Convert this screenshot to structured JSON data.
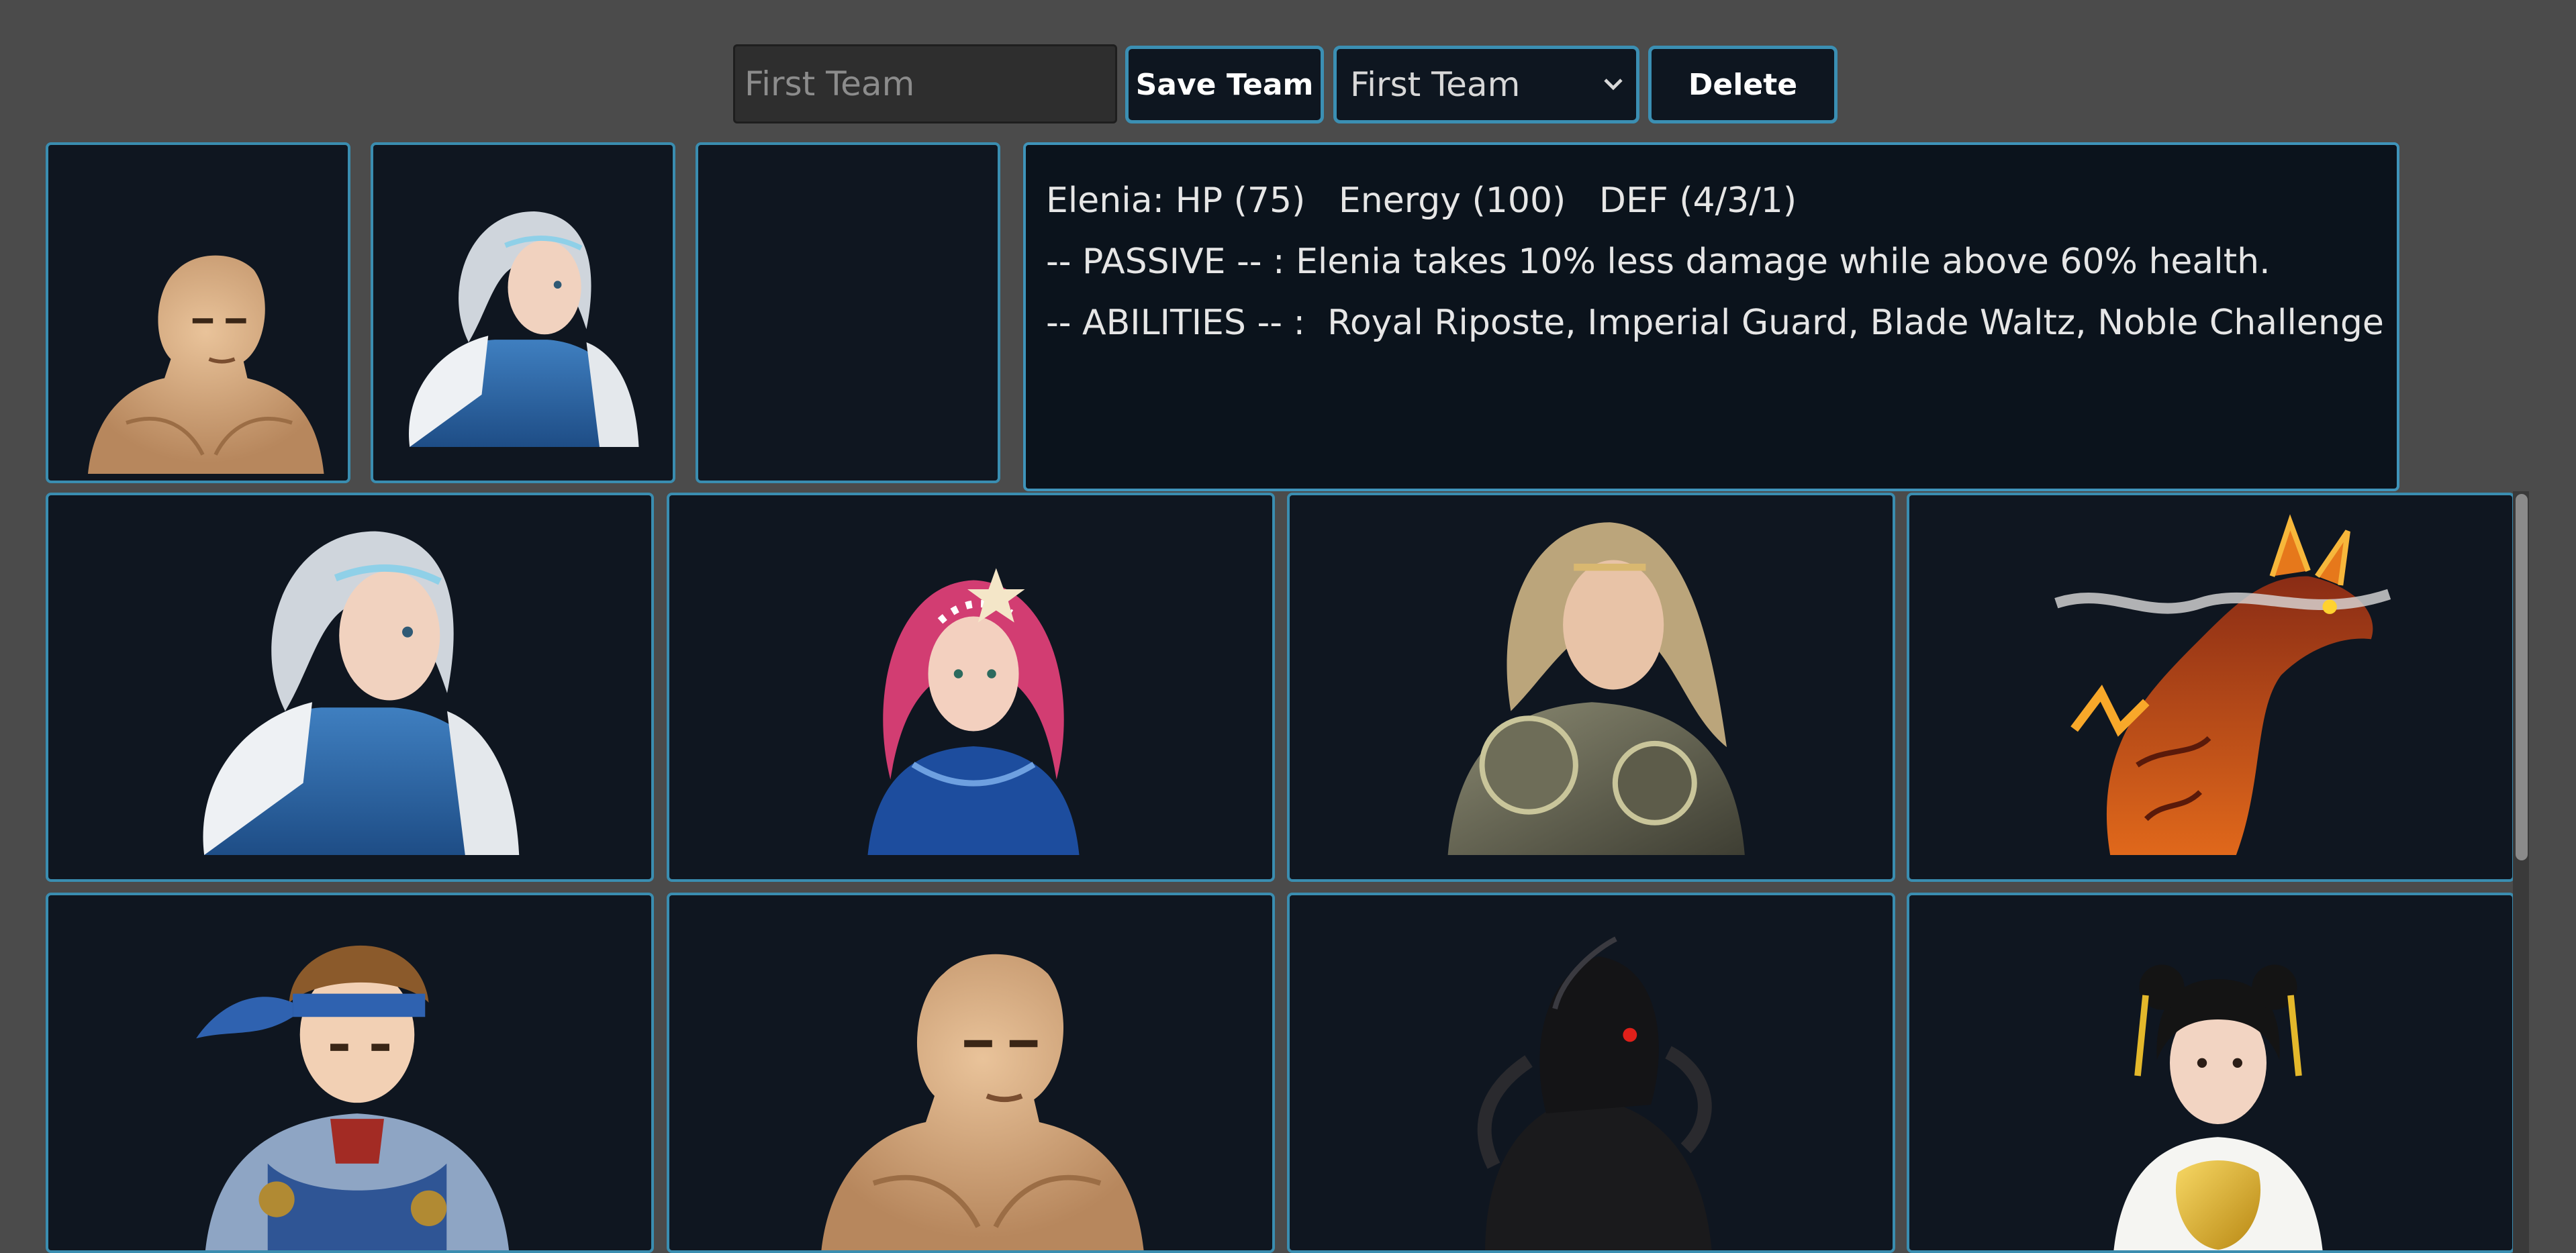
{
  "toolbar": {
    "team_name_value": "First Team",
    "save_label": "Save Team",
    "selected_team": "First Team",
    "delete_label": "Delete"
  },
  "info": {
    "line1": "Elenia: HP (75)   Energy (100)   DEF (4/3/1)",
    "line2": "-- PASSIVE -- : Elenia takes 10% less damage while above 60% health.",
    "line3": "-- ABILITIES -- :  Royal Riposte, Imperial Guard, Blade Waltz, Noble Challenge"
  },
  "team_slots": [
    "bald-monk",
    "silver-haired-queen",
    "empty"
  ],
  "roster": [
    "silver-haired-queen",
    "pink-haired-sea-maiden",
    "armored-warrior-woman",
    "fire-dragon",
    "headband-swordsman",
    "bald-monk",
    "shadow-knight",
    "golden-dragon-empress"
  ],
  "colors": {
    "background": "#4b4b4b",
    "panel": "#0f1620",
    "border_accent": "#3a8db0"
  }
}
